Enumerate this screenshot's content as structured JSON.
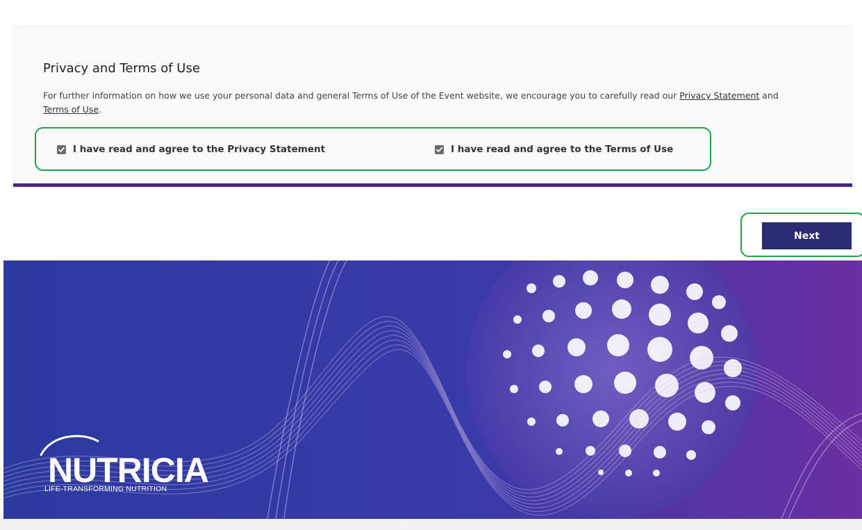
{
  "privacy": {
    "title": "Privacy and Terms of Use",
    "body_prefix": "For further information on how we use your personal data and general Terms of Use of the Event website, we encourage you to carefully read our ",
    "privacy_link": "Privacy Statement",
    "body_middle": " and ",
    "terms_link": "Terms of Use",
    "body_suffix": "."
  },
  "checkboxes": {
    "privacy_label": "I have read and agree to the Privacy Statement",
    "privacy_checked": true,
    "terms_label": "I have read and agree to the Terms of Use",
    "terms_checked": true
  },
  "actions": {
    "next_label": "Next"
  },
  "banner": {
    "brand": "NUTRICIA",
    "tagline": "LIFE-TRANSFORMING NUTRITION"
  },
  "colors": {
    "accent_bar": "#4a2a7d",
    "button": "#2b2b73",
    "highlight": "#1aa34a",
    "banner_left": "#2b3a9e",
    "banner_right": "#6a2fa0"
  }
}
